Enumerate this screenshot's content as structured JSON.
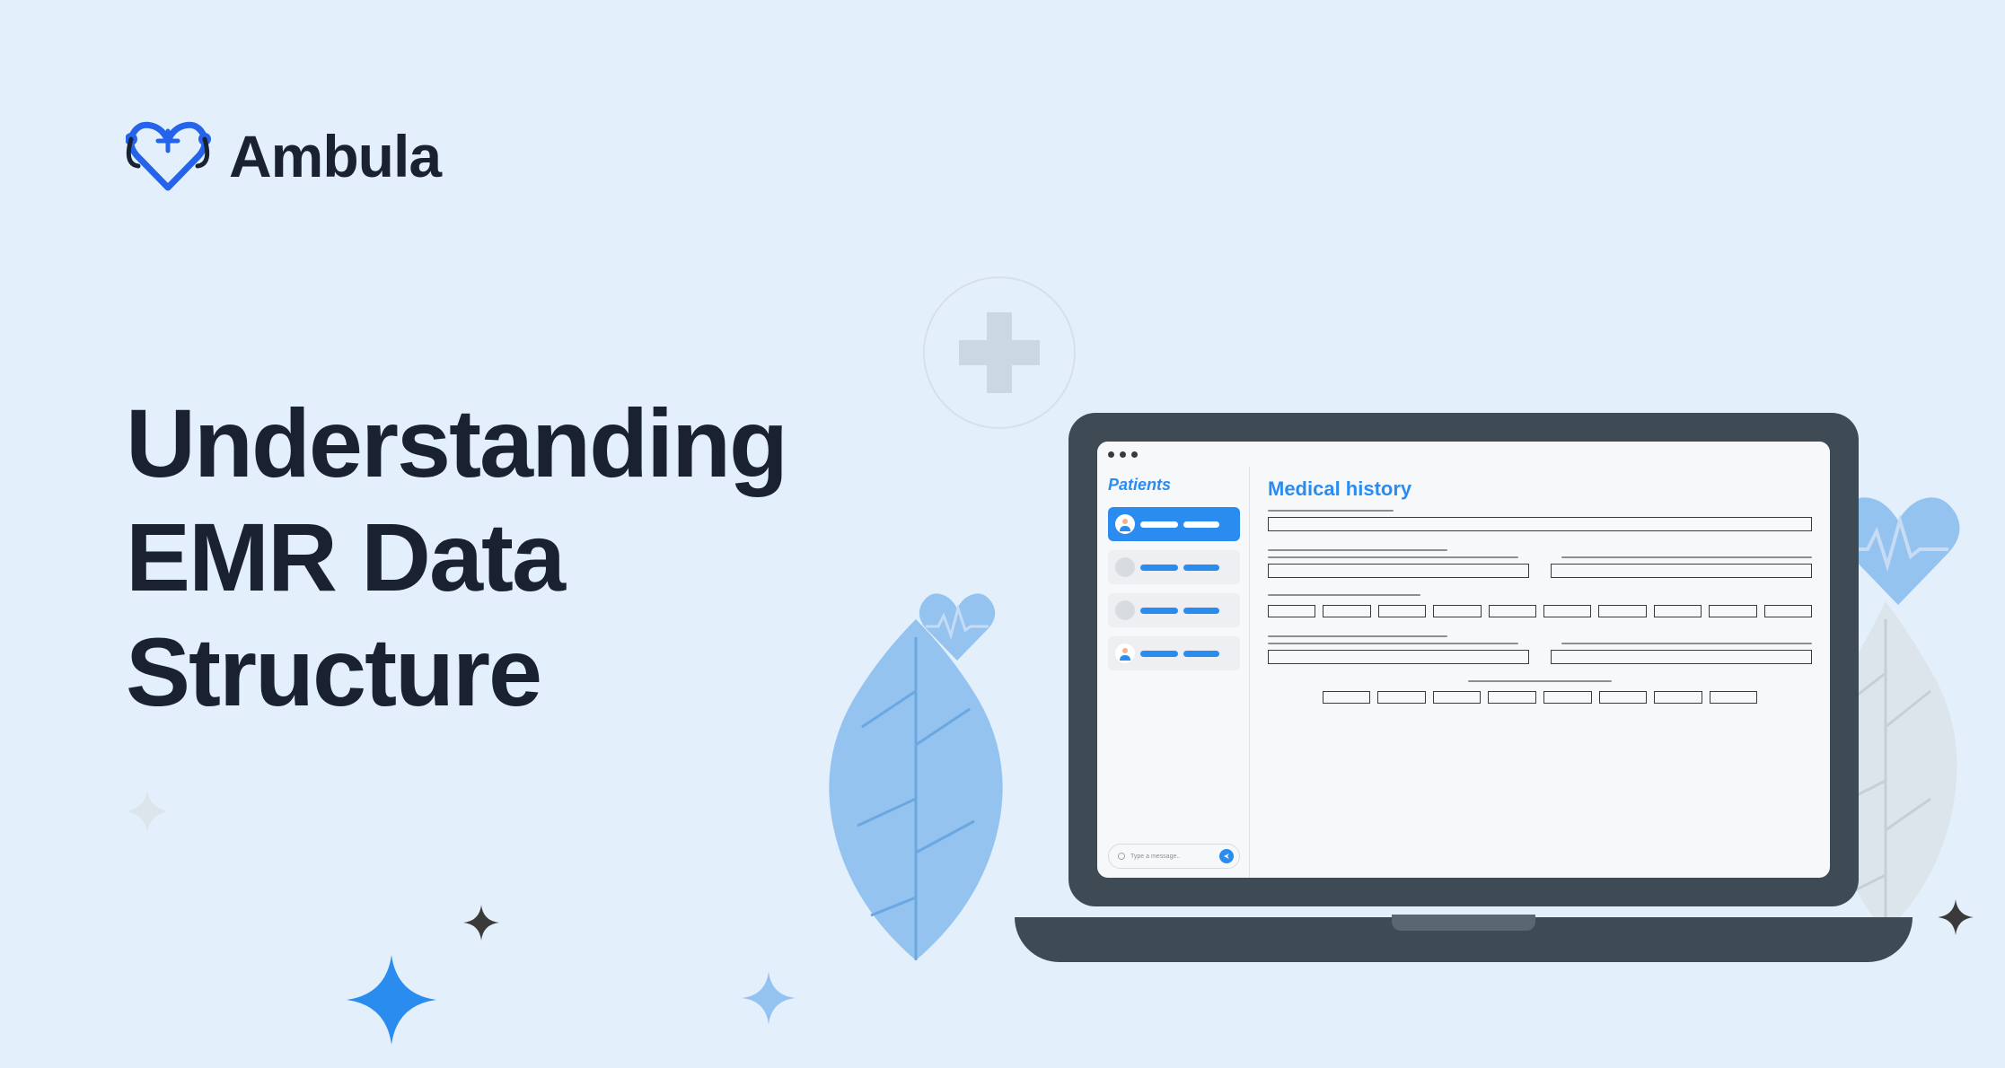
{
  "brand": {
    "name": "Ambula",
    "accent_color": "#2563EB",
    "text_color": "#1A2232"
  },
  "headline": "Understanding EMR Data Structure",
  "illustration": {
    "sidebar_title": "Patients",
    "main_title": "Medical history",
    "message_placeholder": "Type a message..",
    "patients_count": 4
  }
}
